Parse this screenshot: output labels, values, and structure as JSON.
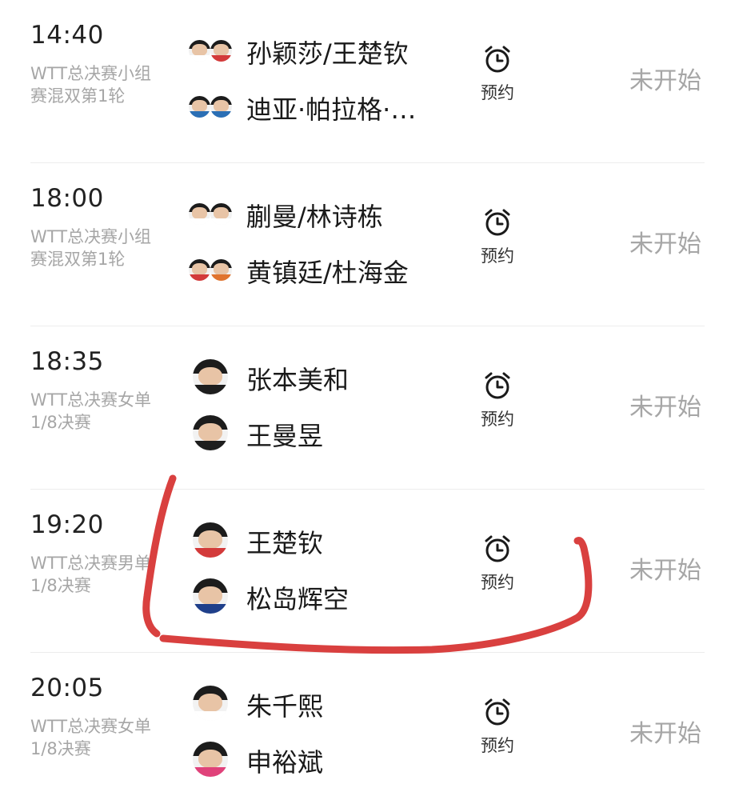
{
  "matches": [
    {
      "time": "14:40",
      "event": "WTT总决赛小组赛混双第1轮",
      "players": [
        {
          "name": "孙颖莎/王楚钦",
          "avatar": "player-pair-avatar",
          "shirt": [
            "#ffffff",
            "#d33a3a"
          ]
        },
        {
          "name": "迪亚·帕拉格·…",
          "avatar": "player-pair-avatar",
          "shirt": [
            "#2b6fb5",
            "#2b6fb5"
          ]
        }
      ],
      "reminder_label": "预约",
      "reminder_icon": "alarm-clock-icon",
      "status": "未开始"
    },
    {
      "time": "18:00",
      "event": "WTT总决赛小组赛混双第1轮",
      "players": [
        {
          "name": "蒯曼/林诗栋",
          "avatar": "player-pair-avatar",
          "shirt": [
            "#ffffff",
            "#ffffff"
          ]
        },
        {
          "name": "黄镇廷/杜海金",
          "avatar": "player-pair-avatar",
          "shirt": [
            "#d33a3a",
            "#e0742f"
          ]
        }
      ],
      "reminder_label": "预约",
      "reminder_icon": "alarm-clock-icon",
      "status": "未开始"
    },
    {
      "time": "18:35",
      "event": "WTT总决赛女单1/8决赛",
      "players": [
        {
          "name": "张本美和",
          "avatar": "player-avatar",
          "shirt": [
            "#1e1e1e"
          ]
        },
        {
          "name": "王曼昱",
          "avatar": "player-avatar",
          "shirt": [
            "#1e1e1e"
          ]
        }
      ],
      "reminder_label": "预约",
      "reminder_icon": "alarm-clock-icon",
      "status": "未开始"
    },
    {
      "time": "19:20",
      "event": "WTT总决赛男单1/8决赛",
      "players": [
        {
          "name": "王楚钦",
          "avatar": "player-avatar",
          "shirt": [
            "#d33a3a"
          ]
        },
        {
          "name": "松岛辉空",
          "avatar": "player-avatar",
          "shirt": [
            "#1f3f8a"
          ]
        }
      ],
      "reminder_label": "预约",
      "reminder_icon": "alarm-clock-icon",
      "status": "未开始"
    },
    {
      "time": "20:05",
      "event": "WTT总决赛女单1/8决赛",
      "players": [
        {
          "name": "朱千熙",
          "avatar": "player-avatar",
          "shirt": [
            "#ffffff"
          ]
        },
        {
          "name": "申裕斌",
          "avatar": "player-avatar",
          "shirt": [
            "#e0427a"
          ]
        }
      ],
      "reminder_label": "预约",
      "reminder_icon": "alarm-clock-icon",
      "status": "未开始"
    }
  ],
  "colors": {
    "annotation_stroke": "#d9403f",
    "muted_text": "#a6a6a6",
    "primary_text": "#1a1a1a"
  }
}
